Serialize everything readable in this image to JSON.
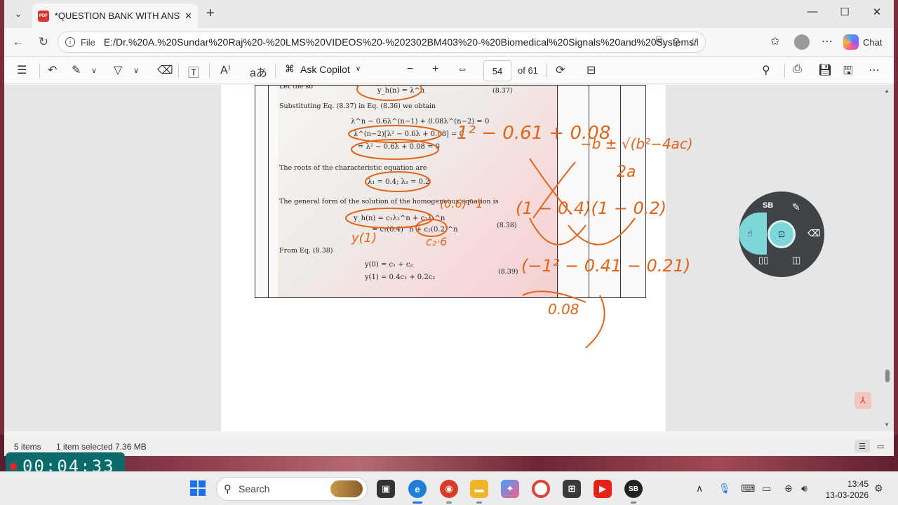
{
  "browser": {
    "tab_title": "*QUESTION BANK WITH ANSWER",
    "pdf_badge": "PDF",
    "url_scheme": "File",
    "url": "E:/Dr.%20A.%20Sundar%20Raj%20-%20LMS%20VIDEOS%20-%202302BM403%20-%20Biomedical%20Signals%20and%20Systems/LMS/...",
    "chat_label": "Chat"
  },
  "pdf_toolbar": {
    "ask_copilot": "Ask Copilot",
    "page_current": "54",
    "page_total": "of 61"
  },
  "document": {
    "lines": [
      "Let the so",
      "y_h(n) = λ^n",
      "(8.37)",
      "Substituting Eq. (8.37) in Eq. (8.36) we obtain",
      "λ^n − 0.6λ^(n−1) + 0.08λ^(n−2) = 0",
      "λ^(n−2)[λ² − 0.6λ + 0.08] = 0",
      "= λ² − 0.6λ + 0.08 = 0",
      "The roots of the characteristic equation are",
      "λ₁ = 0.4; λ₂ = 0.2",
      "The general form of the solution of the homogeneous equation is",
      "y_h(n) = c₁λ₁^n + c₂λ₂^n",
      "= c₁(0.4)^n + c₂(0.2)^n",
      "(8.38)",
      "From Eq. (8.38)",
      "y(0) = c₁ + c₂",
      "y(1) = 0.4c₁ + 0.2c₂",
      "(8.39)"
    ],
    "annotations": [
      "1² − 0.61 + 0.08",
      "−b ± √(b²−4ac)",
      "2a",
      "(1 − 0.4)(1 − 0.2)",
      "(0.6)^1",
      "y(1)",
      "c₂·6",
      "(−1² − 0.41 − 0.21)",
      "0.08"
    ]
  },
  "radial_menu": {
    "sb_label": "SB"
  },
  "status": {
    "items": "5 items",
    "selected": "1 item selected  7.36 MB"
  },
  "recorder": {
    "time": "00:04:33"
  },
  "taskbar": {
    "search_label": "Search",
    "sb_app": "SB",
    "time": "13:45",
    "date": "13-03-2026"
  }
}
